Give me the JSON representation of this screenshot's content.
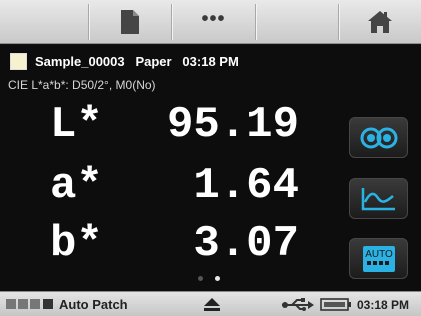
{
  "toolbar": {
    "buttons": [
      {
        "name": "document",
        "icon": "document-icon"
      },
      {
        "name": "more",
        "icon": "more-dots-icon",
        "label": "•••"
      },
      {
        "name": "home",
        "icon": "home-icon"
      }
    ]
  },
  "sample": {
    "swatch_color": "#f6f1cf",
    "title_line": "Sample_00003   Paper   03:18 PM"
  },
  "measurement": {
    "condition": "CIE L*a*b*: D50/2°, M0(No)",
    "values": [
      {
        "name": "L*",
        "value": "95.19"
      },
      {
        "name": "a*",
        "value": "1.64"
      },
      {
        "name": "b*",
        "value": "3.07"
      }
    ]
  },
  "side_buttons": [
    {
      "name": "compare",
      "icon": "compare-icon"
    },
    {
      "name": "spectrum",
      "icon": "spectrum-graph-icon"
    },
    {
      "name": "auto",
      "icon": "auto-icon",
      "label": "AUTO"
    }
  ],
  "pager": {
    "pages": 2,
    "current": 2
  },
  "status_bar": {
    "mode_label": "Auto Patch",
    "time": "03:18 PM",
    "icons": [
      "mode-squares-icon",
      "eject-icon",
      "usb-icon",
      "battery-icon"
    ]
  },
  "colors": {
    "accent": "#2ab2e4",
    "background": "#0d0d0d"
  }
}
